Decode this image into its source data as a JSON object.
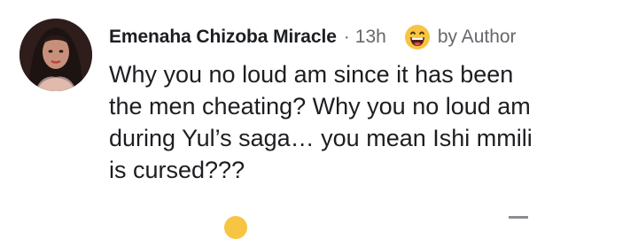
{
  "comment": {
    "author_name": "Emenaha Chizoba Miracle",
    "separator": "·",
    "time": "13h",
    "author_badge_icon": "laughing-emoji-icon",
    "author_badge_label": "by Author",
    "text_lines": [
      "Why you no loud am since it has been",
      "the men cheating? Why you no loud am",
      "during Yul’s saga… you mean Ishi mmili",
      "is cursed???"
    ]
  }
}
